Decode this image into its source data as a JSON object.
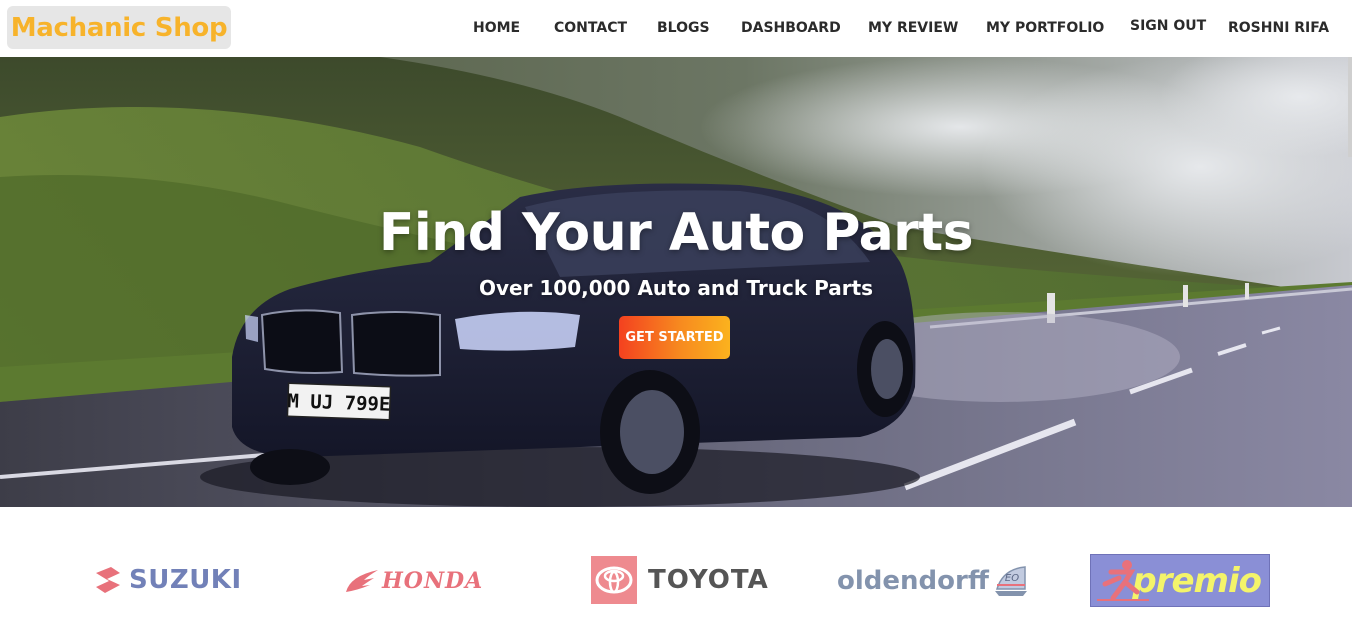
{
  "brand": {
    "name": "Machanic Shop"
  },
  "nav": {
    "items": [
      {
        "label": "HOME",
        "name": "nav-home"
      },
      {
        "label": "CONTACT",
        "name": "nav-contact"
      },
      {
        "label": "BLOGS",
        "name": "nav-blogs"
      },
      {
        "label": "DASHBOARD",
        "name": "nav-dashboard"
      },
      {
        "label": "MY REVIEW",
        "name": "nav-my-review"
      },
      {
        "label": "MY PORTFOLIO",
        "name": "nav-my-portfolio"
      },
      {
        "label": "SIGN OUT",
        "name": "nav-sign-out"
      },
      {
        "label": "ROSHNI RIFA",
        "name": "nav-user-name"
      }
    ]
  },
  "hero": {
    "title": "Find Your Auto Parts",
    "subtitle": "Over 100,000 Auto and Truck Parts",
    "cta_label": "GET STARTED",
    "plate": "M UJ 799E"
  },
  "partners": {
    "suzuki": "SUZUKI",
    "honda": "HONDA",
    "toyota": "TOYOTA",
    "oldendorff": "oldendorff",
    "oldendorff_badge": "EO",
    "premio": "premio"
  },
  "colors": {
    "brand_text": "#f7b32b",
    "cta_start": "#f4411f",
    "cta_end": "#fbb21e",
    "suzuki": "#7281b8",
    "honda": "#e8717b",
    "toyota_badge": "#ee8a8f",
    "premio_bg": "#8a8fd6",
    "premio_text": "#f4f46a"
  }
}
